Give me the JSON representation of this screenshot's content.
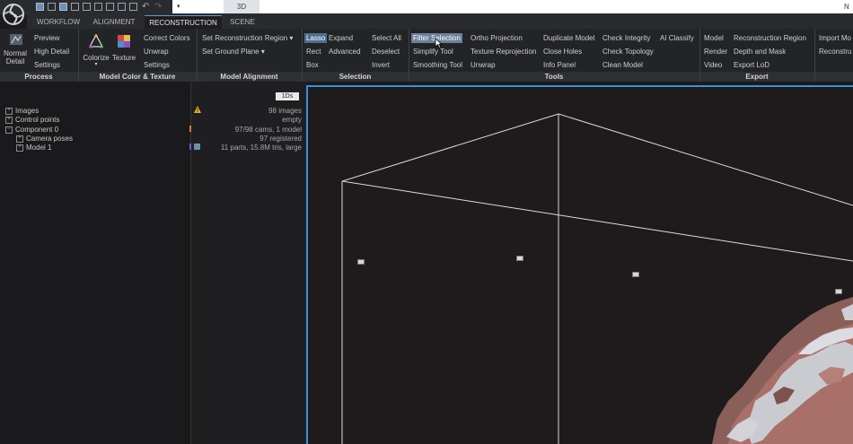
{
  "window": {
    "view_tab": "3D",
    "corner_text": "N"
  },
  "tabs": [
    {
      "label": "WORKFLOW"
    },
    {
      "label": "ALIGNMENT"
    },
    {
      "label": "RECONSTRUCTION"
    },
    {
      "label": "SCENE"
    }
  ],
  "ribbon": {
    "process": {
      "label": "Process",
      "normal_detail_1": "Normal",
      "normal_detail_2": "Detail",
      "items": [
        "Preview",
        "High Detail",
        "Settings"
      ]
    },
    "model_color": {
      "label": "Model Color & Texture",
      "colorize": "Colorize",
      "texture": "Texture",
      "items": [
        "Correct Colors",
        "Unwrap",
        "Settings"
      ]
    },
    "model_alignment": {
      "label": "Model Alignment",
      "items": [
        "Set Reconstruction Region",
        "Set Ground Plane"
      ]
    },
    "selection": {
      "label": "Selection",
      "col1": [
        "Lasso",
        "Rect",
        "Box"
      ],
      "col2": [
        "Expand",
        "Advanced"
      ],
      "col3": [
        "Select All",
        "Deselect",
        "Invert"
      ]
    },
    "tools": {
      "label": "Tools",
      "col1": [
        "Filter Selection",
        "Simplify Tool",
        "Smoothing Tool"
      ],
      "col2": [
        "Ortho Projection",
        "Texture Reprojection",
        "Unwrap"
      ],
      "col3": [
        "Duplicate Model",
        "Close Holes",
        "Info Panel"
      ],
      "col4": [
        "Check Integrity",
        "Check Topology",
        "Clean Model"
      ],
      "col5": [
        "AI Classify"
      ]
    },
    "export": {
      "label": "Export",
      "col1": [
        "Model",
        "Render",
        "Video"
      ],
      "col2": [
        "Reconstruction Region",
        "Depth and Mask",
        "Export LoD"
      ]
    },
    "import": {
      "col1": [
        "Import Mo",
        "Reconstru"
      ]
    }
  },
  "tree": {
    "items": [
      "Images",
      "Control points",
      "Component 0",
      "Camera poses",
      "Model 1"
    ],
    "info_button": "1Ds",
    "info": [
      "98 images",
      "empty",
      "97/98 cams, 1 model",
      "97 registered",
      "11 parts, 15.8M tris, large"
    ]
  },
  "colors": {
    "accent": "#3a8fd8",
    "warning": "#e0b020",
    "panel": "#1a1a1c"
  }
}
